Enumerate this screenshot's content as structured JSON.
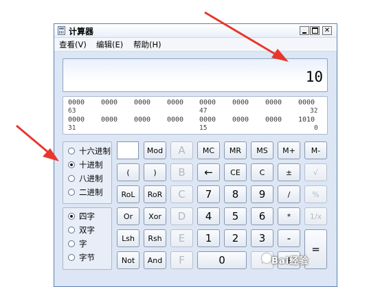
{
  "window": {
    "title": "计算器",
    "menu": [
      "查看(V)",
      "编辑(E)",
      "帮助(H)"
    ]
  },
  "display": {
    "value": "10"
  },
  "bits": {
    "row1": [
      "0000",
      "0000",
      "0000",
      "0000",
      "0000",
      "0000",
      "0000",
      "0000"
    ],
    "row1_positions": [
      "63",
      "47",
      "32"
    ],
    "row2": [
      "0000",
      "0000",
      "0000",
      "0000",
      "0000",
      "0000",
      "0000",
      "1010"
    ],
    "row2_positions": [
      "31",
      "15",
      "0"
    ]
  },
  "base_options": [
    {
      "label": "十六进制",
      "selected": false
    },
    {
      "label": "十进制",
      "selected": true
    },
    {
      "label": "八进制",
      "selected": false
    },
    {
      "label": "二进制",
      "selected": false
    }
  ],
  "word_options": [
    {
      "label": "四字",
      "selected": true
    },
    {
      "label": "双字",
      "selected": false
    },
    {
      "label": "字",
      "selected": false
    },
    {
      "label": "字节",
      "selected": false
    }
  ],
  "keys": {
    "row1": [
      "Mod",
      "A",
      "MC",
      "MR",
      "MS",
      "M+",
      "M-"
    ],
    "row2": [
      "(",
      ")",
      "B",
      "←",
      "CE",
      "C",
      "±",
      "√"
    ],
    "row3": [
      "RoL",
      "RoR",
      "C",
      "7",
      "8",
      "9",
      "/",
      "%"
    ],
    "row4": [
      "Or",
      "Xor",
      "D",
      "4",
      "5",
      "6",
      "*",
      "1/x"
    ],
    "row5": [
      "Lsh",
      "Rsh",
      "E",
      "1",
      "2",
      "3",
      "-",
      "="
    ],
    "row6": [
      "Not",
      "And",
      "F",
      "0",
      ".",
      "+"
    ]
  },
  "watermark": "Bai经验"
}
